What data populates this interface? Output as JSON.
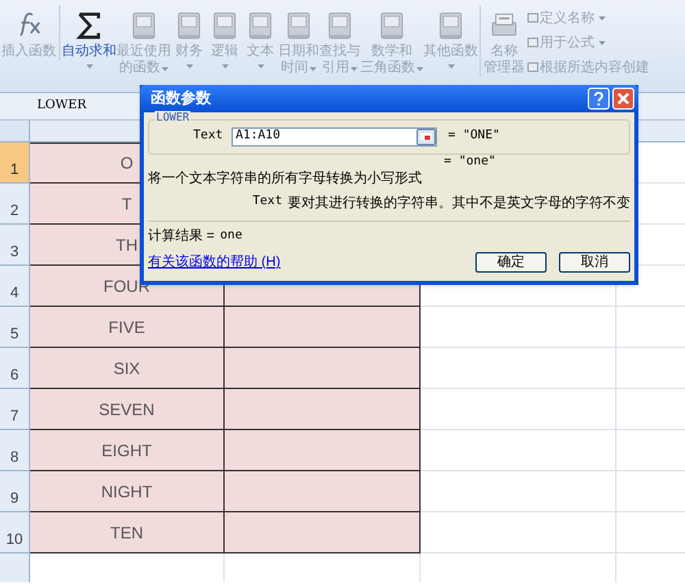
{
  "ribbon": {
    "buttons": [
      {
        "lines": [
          "插入函数"
        ],
        "kind": "fx",
        "dropdown": false,
        "accent": false
      },
      {
        "lines": [
          "自动求和"
        ],
        "kind": "sigma",
        "dropdown": true,
        "accent": true
      },
      {
        "lines": [
          "最近使用",
          "的函数"
        ],
        "kind": "book",
        "dropdown": true,
        "accent": false
      },
      {
        "lines": [
          "财务"
        ],
        "kind": "book",
        "dropdown": true,
        "accent": false
      },
      {
        "lines": [
          "逻辑"
        ],
        "kind": "book",
        "dropdown": true,
        "accent": false
      },
      {
        "lines": [
          "文本"
        ],
        "kind": "book",
        "dropdown": true,
        "accent": false
      },
      {
        "lines": [
          "日期和",
          "时间"
        ],
        "kind": "book",
        "dropdown": true,
        "accent": false
      },
      {
        "lines": [
          "查找与",
          "引用"
        ],
        "kind": "book",
        "dropdown": true,
        "accent": false
      },
      {
        "lines": [
          "数学和",
          "三角函数"
        ],
        "kind": "book",
        "dropdown": true,
        "accent": false
      },
      {
        "lines": [
          "其他函数"
        ],
        "kind": "book",
        "dropdown": true,
        "accent": false
      },
      {
        "lines": [
          "名称",
          "管理器"
        ],
        "kind": "names",
        "dropdown": false,
        "accent": false
      }
    ],
    "small_buttons": [
      {
        "label": "定义名称",
        "dropdown": true
      },
      {
        "label": "用于公式",
        "dropdown": true
      },
      {
        "label": "根据所选内容创建",
        "dropdown": false
      }
    ]
  },
  "name_box": "LOWER",
  "rows": [
    {
      "number": "1",
      "selected": true,
      "a": "O"
    },
    {
      "number": "2",
      "selected": false,
      "a": "T"
    },
    {
      "number": "3",
      "selected": false,
      "a": "TH"
    },
    {
      "number": "4",
      "selected": false,
      "a": "FOUR"
    },
    {
      "number": "5",
      "selected": false,
      "a": "FIVE"
    },
    {
      "number": "6",
      "selected": false,
      "a": "SIX"
    },
    {
      "number": "7",
      "selected": false,
      "a": "SEVEN"
    },
    {
      "number": "8",
      "selected": false,
      "a": "EIGHT"
    },
    {
      "number": "9",
      "selected": false,
      "a": "NIGHT"
    },
    {
      "number": "10",
      "selected": false,
      "a": "TEN"
    }
  ],
  "dialog": {
    "title": "函数参数",
    "function": "LOWER",
    "arg_label": "Text",
    "arg_value": "A1:A10",
    "arg_result": "= \"ONE\"",
    "result_preview": "= \"one\"",
    "description": "将一个文本字符串的所有字母转换为小写形式",
    "arg_name": "Text",
    "arg_description": "要对其进行转换的字符串。其中不是英文字母的字符不变",
    "result_label": "计算结果 =",
    "result_value": "one",
    "help_link": "有关该函数的帮助 (H)",
    "buttons": [
      "确定",
      "取消"
    ]
  }
}
